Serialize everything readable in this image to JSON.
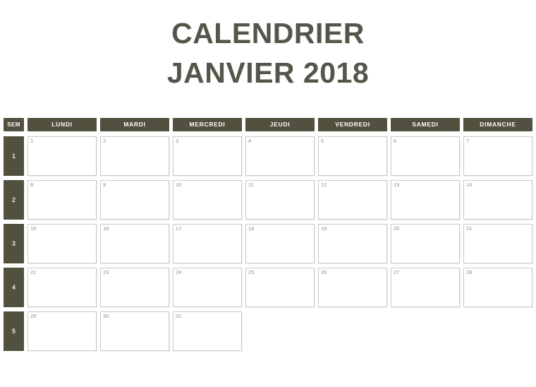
{
  "title": {
    "line1": "CALENDRIER",
    "line2": "JANVIER 2018"
  },
  "colors": {
    "header_bg": "#52513f",
    "header_text": "#ffffff",
    "title_text": "#55554a",
    "cell_border": "#c9c9c4",
    "cell_bg": "#ffffff",
    "day_number_text": "#8d8d88",
    "week_number_text": "#e8e8e0",
    "page_bg": "#ffffff"
  },
  "header": {
    "week_column_label": "SEM",
    "day_labels": [
      "LUNDI",
      "MARDI",
      "MERCREDI",
      "JEUDI",
      "VENDREDI",
      "SAMEDI",
      "DIMANCHE"
    ]
  },
  "weeks": [
    {
      "week_number": "1",
      "days": [
        "1",
        "2",
        "3",
        "4",
        "5",
        "6",
        "7"
      ]
    },
    {
      "week_number": "2",
      "days": [
        "8",
        "9",
        "10",
        "11",
        "12",
        "13",
        "14"
      ]
    },
    {
      "week_number": "3",
      "days": [
        "15",
        "16",
        "17",
        "18",
        "19",
        "20",
        "21"
      ]
    },
    {
      "week_number": "4",
      "days": [
        "22",
        "23",
        "24",
        "25",
        "26",
        "27",
        "28"
      ]
    },
    {
      "week_number": "5",
      "days": [
        "29",
        "30",
        "31",
        "",
        "",
        "",
        ""
      ]
    }
  ]
}
